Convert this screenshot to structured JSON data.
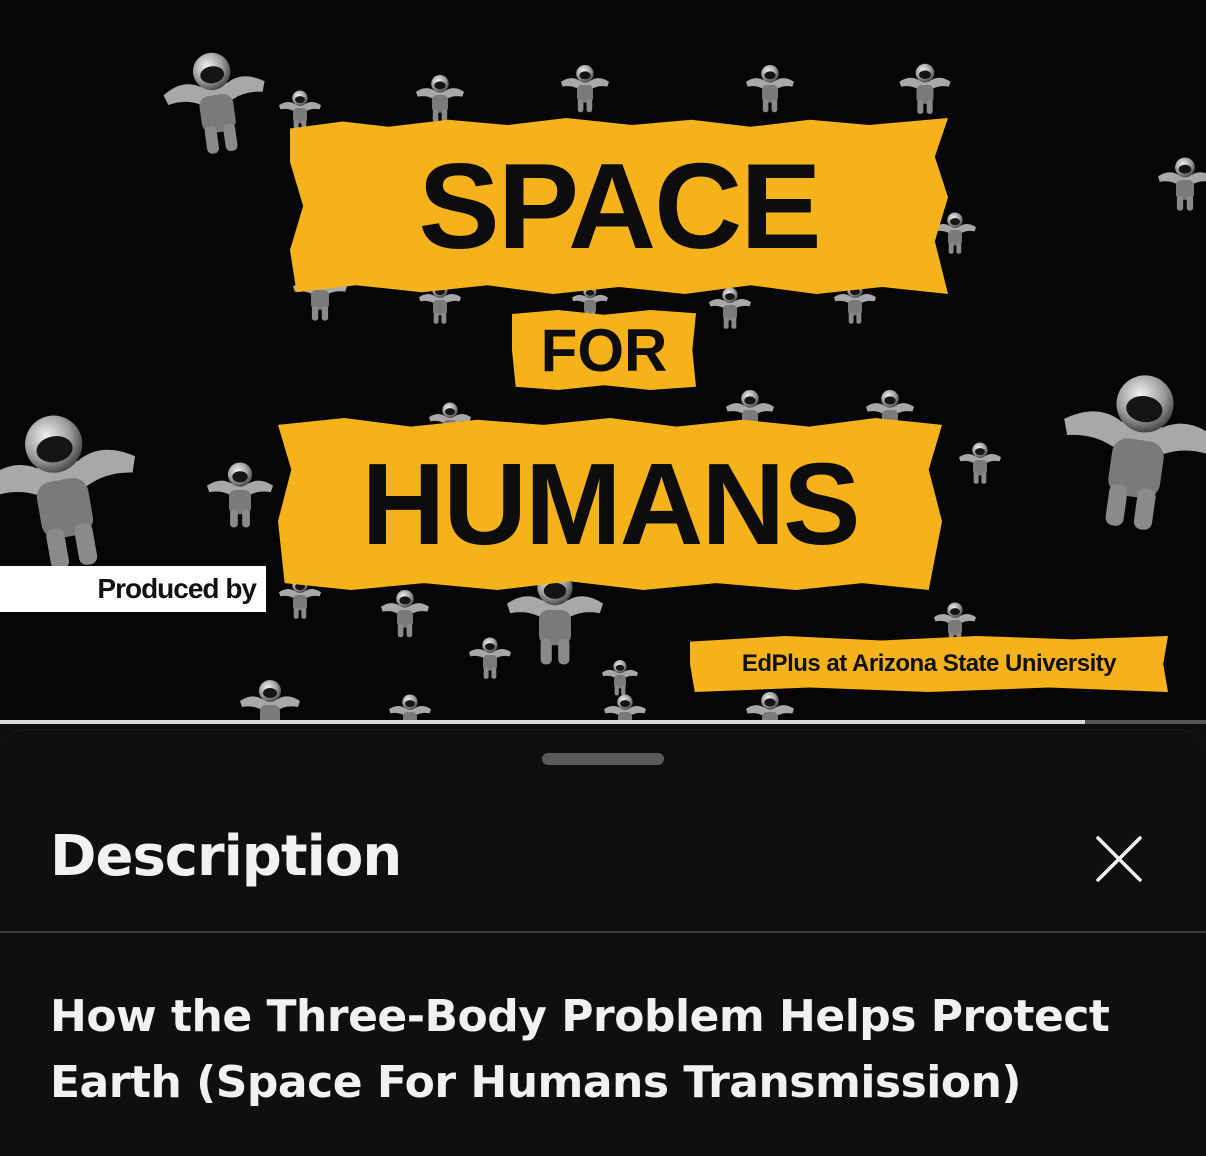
{
  "video": {
    "thumbnail": {
      "line1": "SPACE",
      "line2": "FOR",
      "line3": "HUMANS",
      "produced_by": "Produced by",
      "producer": "EdPlus at Arizona State University"
    },
    "accent_color": "#f6b21b",
    "progress_fraction": 0.9
  },
  "sheet": {
    "title": "Description",
    "close_icon": "close-icon",
    "video_title": "How the Three-Body Problem Helps Protect Earth (Space For Humans Transmission)"
  }
}
